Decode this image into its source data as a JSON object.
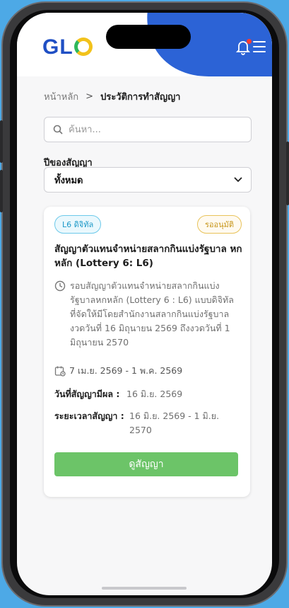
{
  "header": {
    "logo_text": "GL",
    "accent_color": "#2c63d6",
    "notification_dot_color": "#ff3b30"
  },
  "breadcrumb": {
    "home": "หน้าหลัก",
    "separator": ">",
    "current": "ประวัติการทำสัญญา"
  },
  "search": {
    "placeholder": "ค้นหา..."
  },
  "filter": {
    "label": "ปีของสัญญา",
    "selected": "ทั้งหมด"
  },
  "contract": {
    "type_badge": "L6 ดิจิทัล",
    "status_badge": "รออนุมัติ",
    "title": "สัญญาตัวแทนจำหน่ายสลากกินแบ่งรัฐบาล หกหลัก (Lottery 6: L6)",
    "description": "รอบสัญญาตัวแทนจำหน่ายสลากกินแบ่งรัฐบาลหกหลัก (Lottery 6 : L6) แบบดิจิทัล ที่จัดให้มีโดยสำนักงานสลากกินแบ่งรัฐบาล งวดวันที่ 16 มิถุนายน 2569 ถึงงวดวันที่ 1 มิถุนายน 2570",
    "date_range": "7 เม.ย. 2569 - 1 พ.ค. 2569",
    "effective_label": "วันที่สัญญามีผล :",
    "effective_value": "16 มิ.ย. 2569",
    "period_label": "ระยะเวลาสัญญา :",
    "period_value": "16 มิ.ย. 2569 - 1 มิ.ย. 2570",
    "button_label": "ดูสัญญา",
    "button_color": "#6cc468"
  }
}
